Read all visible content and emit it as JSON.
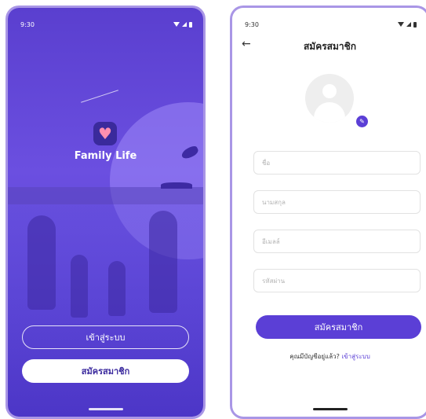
{
  "left_screen": {
    "status_time": "9:30",
    "app_name": "Family Life",
    "login_button": "เข้าสู่ระบบ",
    "register_button": "สมัครสมาชิก"
  },
  "right_screen": {
    "status_time": "9:30",
    "title": "สมัครสมาชิก",
    "fields": [
      {
        "placeholder": "ชื่อ"
      },
      {
        "placeholder": "นามสกุล"
      },
      {
        "placeholder": "อีเมลล์"
      },
      {
        "placeholder": "รหัสผ่าน"
      }
    ],
    "submit_button": "สมัครสมาชิก",
    "have_account_text": "คุณมีบัญชีอยู่แล้ว?",
    "login_link": "เข้าสู่ระบบ"
  },
  "colors": {
    "primary": "#5b3fd6",
    "left_background": "#5a3fcf",
    "frame": "#a996e6"
  },
  "icons": [
    "wifi-icon",
    "signal-icon",
    "battery-icon",
    "heart-logo-icon",
    "back-arrow-icon",
    "avatar-placeholder-icon",
    "edit-pencil-icon"
  ]
}
